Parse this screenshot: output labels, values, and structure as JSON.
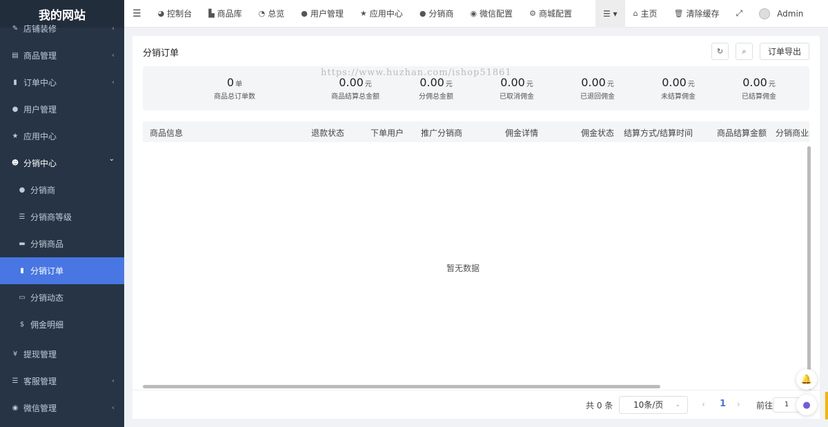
{
  "brand": "我的网站",
  "sidebar": {
    "items": [
      {
        "label": "店铺装修",
        "icon": "brush-icon",
        "caret": "‹"
      },
      {
        "label": "商品管理",
        "icon": "box-icon",
        "caret": "‹"
      },
      {
        "label": "订单中心",
        "icon": "file-icon",
        "caret": "‹"
      },
      {
        "label": "用户管理",
        "icon": "user-icon",
        "caret": ""
      },
      {
        "label": "应用中心",
        "icon": "star-icon",
        "caret": ""
      },
      {
        "label": "分销中心",
        "icon": "users-icon",
        "caret": "⌄"
      },
      {
        "label": "分销商",
        "icon": "user-icon",
        "caret": ""
      },
      {
        "label": "分销商等级",
        "icon": "list-icon",
        "caret": ""
      },
      {
        "label": "分销商品",
        "icon": "briefcase-icon",
        "caret": ""
      },
      {
        "label": "分销订单",
        "icon": "file-icon",
        "caret": ""
      },
      {
        "label": "分销动态",
        "icon": "id-card-icon",
        "caret": ""
      },
      {
        "label": "佣金明细",
        "icon": "dollar-icon",
        "caret": ""
      },
      {
        "label": "提现管理",
        "icon": "yen-icon",
        "caret": ""
      },
      {
        "label": "客服管理",
        "icon": "list-icon",
        "caret": "‹"
      },
      {
        "label": "微信管理",
        "icon": "wechat-icon",
        "caret": "‹"
      }
    ]
  },
  "topbar": {
    "items": [
      {
        "label": "控制台",
        "icon": "dashboard-icon"
      },
      {
        "label": "商品库",
        "icon": "shop-icon"
      },
      {
        "label": "总览",
        "icon": "pie-icon"
      },
      {
        "label": "用户管理",
        "icon": "user-icon"
      },
      {
        "label": "应用中心",
        "icon": "star-icon"
      },
      {
        "label": "分销商",
        "icon": "user-icon"
      },
      {
        "label": "微信配置",
        "icon": "wechat-icon"
      },
      {
        "label": "商城配置",
        "icon": "gears-icon"
      }
    ],
    "home": "主页",
    "clear_cache": "清除缓存",
    "admin": "Admin"
  },
  "page": {
    "title": "分销订单",
    "export_label": "订单导出",
    "watermark": "https://www.huzhan.com/ishop51861"
  },
  "stats": [
    {
      "value": "0",
      "unit": "单",
      "label": "商品总订单数"
    },
    {
      "value": "0.00",
      "unit": "元",
      "label": "商品结算总金额"
    },
    {
      "value": "0.00",
      "unit": "元",
      "label": "分佣总金额"
    },
    {
      "value": "0.00",
      "unit": "元",
      "label": "已取消佣金"
    },
    {
      "value": "0.00",
      "unit": "元",
      "label": "已退回佣金"
    },
    {
      "value": "0.00",
      "unit": "元",
      "label": "未结算佣金"
    },
    {
      "value": "0.00",
      "unit": "元",
      "label": "已结算佣金"
    }
  ],
  "table": {
    "headers": [
      "商品信息",
      "退款状态",
      "下单用户",
      "推广分销商",
      "佣金详情",
      "佣金状态",
      "结算方式/结算时间",
      "商品结算金额",
      "分销商业绩"
    ],
    "empty_text": "暂无数据"
  },
  "pagination": {
    "total": "共 0 条",
    "page_size": "10条/页",
    "current": "1",
    "goto_label": "前往",
    "goto_value": "1"
  },
  "colors": {
    "accent": "#4876e3",
    "sidebar": "#263445"
  }
}
